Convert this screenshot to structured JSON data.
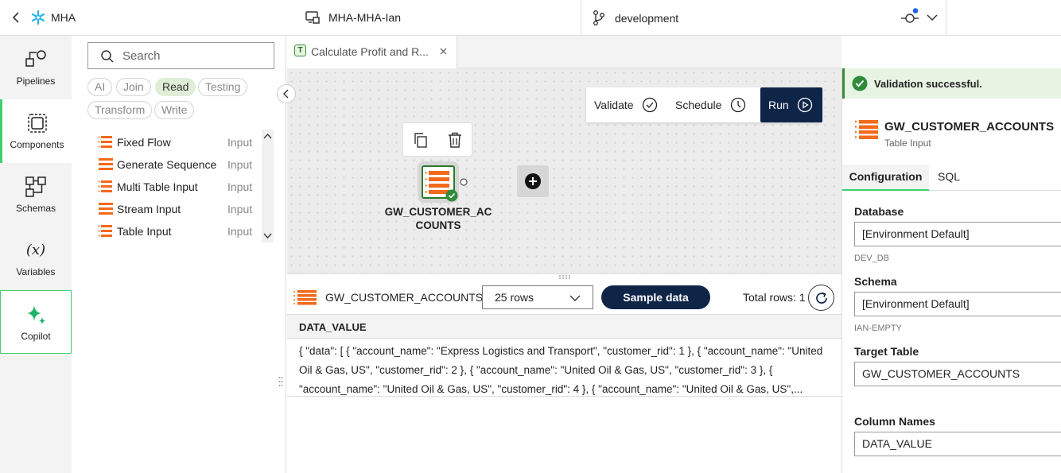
{
  "topbar": {
    "back_icon": "chevron-left-icon",
    "project_label": "MHA",
    "environment_label": "MHA-MHA-Ian",
    "branch_label": "development"
  },
  "leftnav": {
    "items": [
      {
        "label": "Pipelines",
        "icon": "pipeline-icon"
      },
      {
        "label": "Components",
        "icon": "components-icon"
      },
      {
        "label": "Schemas",
        "icon": "schema-icon"
      },
      {
        "label": "Variables",
        "icon": "variable-icon"
      },
      {
        "label": "Copilot",
        "icon": "sparkle-icon"
      }
    ]
  },
  "panel": {
    "search_placeholder": "Search",
    "filters": [
      "AI",
      "Join",
      "Read",
      "Testing",
      "Transform",
      "Write"
    ],
    "selected_filter": "Read",
    "components": [
      {
        "name": "Fixed Flow",
        "type": "Input"
      },
      {
        "name": "Generate Sequence",
        "type": "Input"
      },
      {
        "name": "Multi Table Input",
        "type": "Input"
      },
      {
        "name": "Stream Input",
        "type": "Input"
      },
      {
        "name": "Table Input",
        "type": "Input"
      }
    ]
  },
  "tab": {
    "badge": "T",
    "label": "Calculate Profit and R..."
  },
  "canvas": {
    "validate_label": "Validate",
    "schedule_label": "Schedule",
    "run_label": "Run",
    "node_label": "GW_CUSTOMER_ACCOUNTS"
  },
  "bottom": {
    "component_name": "GW_CUSTOMER_ACCOUNTS",
    "rows_select": "25 rows",
    "sample_button": "Sample data",
    "total_rows": "Total rows: 1",
    "column_header": "DATA_VALUE",
    "cell_value": "{ \"data\": [ { \"account_name\": \"Express Logistics and Transport\", \"customer_rid\": 1 }, { \"account_name\": \"United Oil & Gas, US\", \"customer_rid\": 2 }, { \"account_name\": \"United Oil & Gas, US\", \"customer_rid\": 3 }, { \"account_name\": \"United Oil & Gas, US\", \"customer_rid\": 4 }, { \"account_name\": \"United Oil & Gas, US\",..."
  },
  "right": {
    "validation_message": "Validation successful.",
    "component_title": "GW_CUSTOMER_ACCOUNTS",
    "component_type": "Table Input",
    "tabs": [
      "Configuration",
      "SQL"
    ],
    "database_label": "Database",
    "database_value": "[Environment Default]",
    "database_hint": "DEV_DB",
    "schema_label": "Schema",
    "schema_value": "[Environment Default]",
    "schema_hint": "IAN-EMPTY",
    "target_table_label": "Target Table",
    "target_table_value": "GW_CUSTOMER_ACCOUNTS",
    "column_names_label": "Column Names",
    "column_names_value": "DATA_VALUE"
  },
  "colors": {
    "accent_green": "#3fcf6e",
    "run_button": "#0f2548",
    "success": "#2e8b3a",
    "stack_orange": "#f26a1b"
  }
}
